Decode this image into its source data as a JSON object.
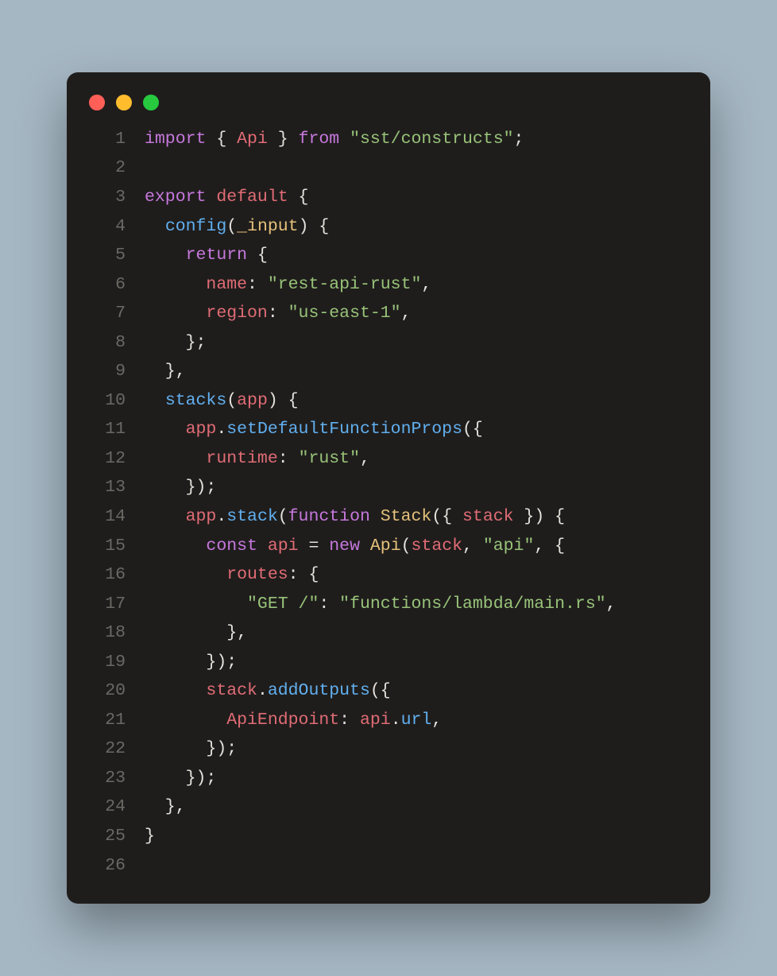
{
  "window": {
    "buttons": [
      "close",
      "minimize",
      "zoom"
    ]
  },
  "editor": {
    "line_count": 26,
    "lines": [
      {
        "n": 1,
        "tokens": [
          {
            "t": "import ",
            "c": "kw-import"
          },
          {
            "t": "{ ",
            "c": "brace"
          },
          {
            "t": "Api",
            "c": "ident"
          },
          {
            "t": " } ",
            "c": "brace"
          },
          {
            "t": "from ",
            "c": "kw-import"
          },
          {
            "t": "\"sst/constructs\"",
            "c": "str"
          },
          {
            "t": ";",
            "c": "punct"
          }
        ]
      },
      {
        "n": 2,
        "tokens": [
          {
            "t": "",
            "c": "punct"
          }
        ]
      },
      {
        "n": 3,
        "tokens": [
          {
            "t": "export ",
            "c": "kw-export"
          },
          {
            "t": "default ",
            "c": "kw-default"
          },
          {
            "t": "{",
            "c": "brace"
          }
        ]
      },
      {
        "n": 4,
        "tokens": [
          {
            "t": "  ",
            "c": "punct"
          },
          {
            "t": "config",
            "c": "fn"
          },
          {
            "t": "(",
            "c": "punct"
          },
          {
            "t": "_input",
            "c": "param"
          },
          {
            "t": ") {",
            "c": "punct"
          }
        ]
      },
      {
        "n": 5,
        "tokens": [
          {
            "t": "    ",
            "c": "punct"
          },
          {
            "t": "return ",
            "c": "kw-return"
          },
          {
            "t": "{",
            "c": "brace"
          }
        ]
      },
      {
        "n": 6,
        "tokens": [
          {
            "t": "      ",
            "c": "punct"
          },
          {
            "t": "name",
            "c": "prop"
          },
          {
            "t": ": ",
            "c": "punct"
          },
          {
            "t": "\"rest-api-rust\"",
            "c": "str"
          },
          {
            "t": ",",
            "c": "punct"
          }
        ]
      },
      {
        "n": 7,
        "tokens": [
          {
            "t": "      ",
            "c": "punct"
          },
          {
            "t": "region",
            "c": "prop"
          },
          {
            "t": ": ",
            "c": "punct"
          },
          {
            "t": "\"us-east-1\"",
            "c": "str"
          },
          {
            "t": ",",
            "c": "punct"
          }
        ]
      },
      {
        "n": 8,
        "tokens": [
          {
            "t": "    };",
            "c": "punct"
          }
        ]
      },
      {
        "n": 9,
        "tokens": [
          {
            "t": "  },",
            "c": "punct"
          }
        ]
      },
      {
        "n": 10,
        "tokens": [
          {
            "t": "  ",
            "c": "punct"
          },
          {
            "t": "stacks",
            "c": "fn"
          },
          {
            "t": "(",
            "c": "punct"
          },
          {
            "t": "app",
            "c": "var"
          },
          {
            "t": ") {",
            "c": "punct"
          }
        ]
      },
      {
        "n": 11,
        "tokens": [
          {
            "t": "    ",
            "c": "punct"
          },
          {
            "t": "app",
            "c": "var"
          },
          {
            "t": ".",
            "c": "dot"
          },
          {
            "t": "setDefaultFunctionProps",
            "c": "fn"
          },
          {
            "t": "({",
            "c": "punct"
          }
        ]
      },
      {
        "n": 12,
        "tokens": [
          {
            "t": "      ",
            "c": "punct"
          },
          {
            "t": "runtime",
            "c": "prop"
          },
          {
            "t": ": ",
            "c": "punct"
          },
          {
            "t": "\"rust\"",
            "c": "str"
          },
          {
            "t": ",",
            "c": "punct"
          }
        ]
      },
      {
        "n": 13,
        "tokens": [
          {
            "t": "    });",
            "c": "punct"
          }
        ]
      },
      {
        "n": 14,
        "tokens": [
          {
            "t": "    ",
            "c": "punct"
          },
          {
            "t": "app",
            "c": "var"
          },
          {
            "t": ".",
            "c": "dot"
          },
          {
            "t": "stack",
            "c": "fn"
          },
          {
            "t": "(",
            "c": "punct"
          },
          {
            "t": "function ",
            "c": "kw-function"
          },
          {
            "t": "Stack",
            "c": "classname"
          },
          {
            "t": "({ ",
            "c": "punct"
          },
          {
            "t": "stack",
            "c": "var"
          },
          {
            "t": " }) {",
            "c": "punct"
          }
        ]
      },
      {
        "n": 15,
        "tokens": [
          {
            "t": "      ",
            "c": "punct"
          },
          {
            "t": "const ",
            "c": "kw-const"
          },
          {
            "t": "api",
            "c": "var"
          },
          {
            "t": " = ",
            "c": "punct"
          },
          {
            "t": "new ",
            "c": "kw-new"
          },
          {
            "t": "Api",
            "c": "classname"
          },
          {
            "t": "(",
            "c": "punct"
          },
          {
            "t": "stack",
            "c": "var"
          },
          {
            "t": ", ",
            "c": "punct"
          },
          {
            "t": "\"api\"",
            "c": "str"
          },
          {
            "t": ", {",
            "c": "punct"
          }
        ]
      },
      {
        "n": 16,
        "tokens": [
          {
            "t": "        ",
            "c": "punct"
          },
          {
            "t": "routes",
            "c": "prop"
          },
          {
            "t": ": {",
            "c": "punct"
          }
        ]
      },
      {
        "n": 17,
        "tokens": [
          {
            "t": "          ",
            "c": "punct"
          },
          {
            "t": "\"GET /\"",
            "c": "str"
          },
          {
            "t": ": ",
            "c": "punct"
          },
          {
            "t": "\"functions/lambda/main.rs\"",
            "c": "str"
          },
          {
            "t": ",",
            "c": "punct"
          }
        ]
      },
      {
        "n": 18,
        "tokens": [
          {
            "t": "        },",
            "c": "punct"
          }
        ]
      },
      {
        "n": 19,
        "tokens": [
          {
            "t": "      });",
            "c": "punct"
          }
        ]
      },
      {
        "n": 20,
        "tokens": [
          {
            "t": "      ",
            "c": "punct"
          },
          {
            "t": "stack",
            "c": "var"
          },
          {
            "t": ".",
            "c": "dot"
          },
          {
            "t": "addOutputs",
            "c": "fn"
          },
          {
            "t": "({",
            "c": "punct"
          }
        ]
      },
      {
        "n": 21,
        "tokens": [
          {
            "t": "        ",
            "c": "punct"
          },
          {
            "t": "ApiEndpoint",
            "c": "prop"
          },
          {
            "t": ": ",
            "c": "punct"
          },
          {
            "t": "api",
            "c": "var"
          },
          {
            "t": ".",
            "c": "dot"
          },
          {
            "t": "url",
            "c": "fn"
          },
          {
            "t": ",",
            "c": "punct"
          }
        ]
      },
      {
        "n": 22,
        "tokens": [
          {
            "t": "      });",
            "c": "punct"
          }
        ]
      },
      {
        "n": 23,
        "tokens": [
          {
            "t": "    });",
            "c": "punct"
          }
        ]
      },
      {
        "n": 24,
        "tokens": [
          {
            "t": "  },",
            "c": "punct"
          }
        ]
      },
      {
        "n": 25,
        "tokens": [
          {
            "t": "}",
            "c": "brace"
          }
        ]
      },
      {
        "n": 26,
        "tokens": [
          {
            "t": "",
            "c": "punct"
          }
        ]
      }
    ]
  }
}
